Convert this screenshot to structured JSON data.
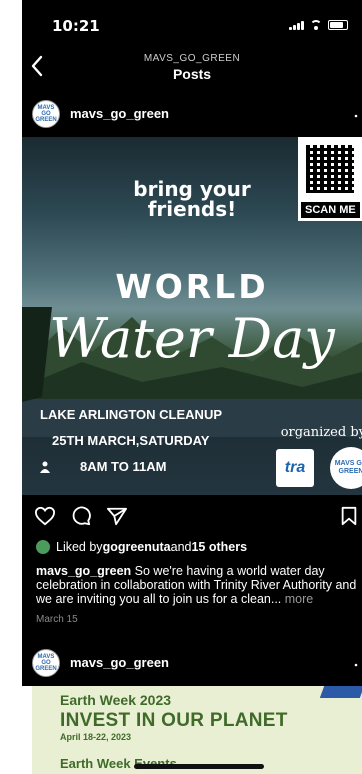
{
  "status_bar": {
    "time": "10:21"
  },
  "nav": {
    "back_icon": "chevron-left-icon",
    "subtitle": "MAVS_GO_GREEN",
    "title": "Posts"
  },
  "post1": {
    "username": "mavs_go_green",
    "avatar_text": "MAVS GO GREEN",
    "more_icon": "more-dots",
    "image": {
      "qr_label": "SCAN ME",
      "bring": "bring your friends!",
      "world": "WORLD",
      "water_day": "Water Day",
      "lake": "LAKE ARLINGTON CLEANUP",
      "date": "25TH MARCH,SATURDAY",
      "time": "8AM TO 11AM",
      "organized": "organized by",
      "tra_logo": "tra",
      "mavs_logo": "MAVS GO GREEN"
    },
    "liked_prefix": "Liked by ",
    "liked_user": "gogreenuta",
    "liked_and": " and ",
    "liked_count": "15 others",
    "caption_user": "mavs_go_green",
    "caption_text": " So we're having a world water day celebration in collaboration with Trinity River Authority and we are inviting you all to join us for a clean...",
    "caption_more": " more",
    "date": "March 15"
  },
  "post2": {
    "username": "mavs_go_green",
    "avatar_text": "MAVS GO GREEN",
    "image": {
      "earth_week": "Earth Week 2023",
      "invest": "INVEST IN OUR PLANET",
      "dates": "April 18-22, 2023",
      "events": "Earth Week Events"
    }
  },
  "colors": {
    "background": "#000000",
    "text": "#ffffff",
    "muted": "#8a8a8a",
    "poster_green": "#3f6a2a"
  }
}
